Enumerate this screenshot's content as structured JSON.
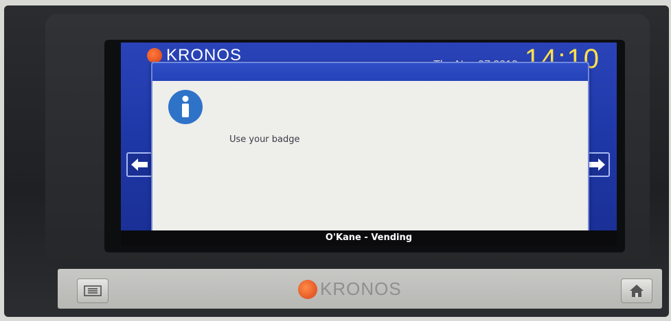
{
  "header": {
    "brand": "KRONOS",
    "date": "Thu Nov 07 2013",
    "time": "14:10"
  },
  "dialog": {
    "icon": "info-icon",
    "message": "Use your badge"
  },
  "location": "O'Kane - Vending",
  "bottom_panel": {
    "brand": "KRONOS",
    "menu_icon": "menu-icon",
    "home_icon": "home-icon"
  },
  "colors": {
    "screen_blue": "#1f38a8",
    "time_yellow": "#ffe24a",
    "info_blue": "#2f73c9",
    "logo_orange": "#d8431a"
  }
}
